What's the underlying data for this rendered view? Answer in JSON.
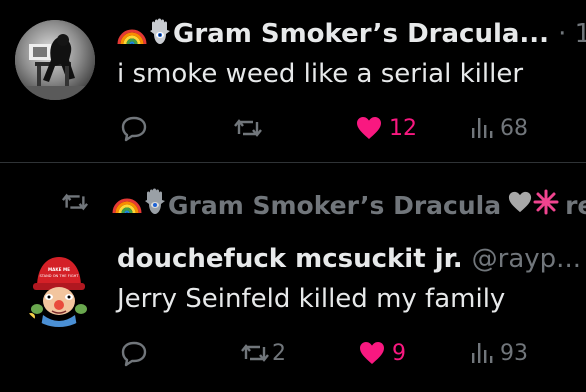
{
  "tweet1": {
    "author_name": "Gram Smoker’s Dracula...",
    "separator": "· 1",
    "text": "i smoke weed like a serial killer",
    "likes": "12",
    "views": "68",
    "colors": {
      "like": "#f91880",
      "muted": "#71767b"
    }
  },
  "tweet2": {
    "retweeted_by": "Gram Smoker’s Dracula",
    "retweeted_by_suffix": "rep",
    "author_name": "douchefuck mcsuckit jr.",
    "handle": "@rayp...",
    "text": "Jerry Seinfeld killed my family",
    "retweets": "2",
    "likes": "9",
    "views": "93",
    "avatar_hat_text": "MAKE ME STAND ON THE FIGHT"
  }
}
